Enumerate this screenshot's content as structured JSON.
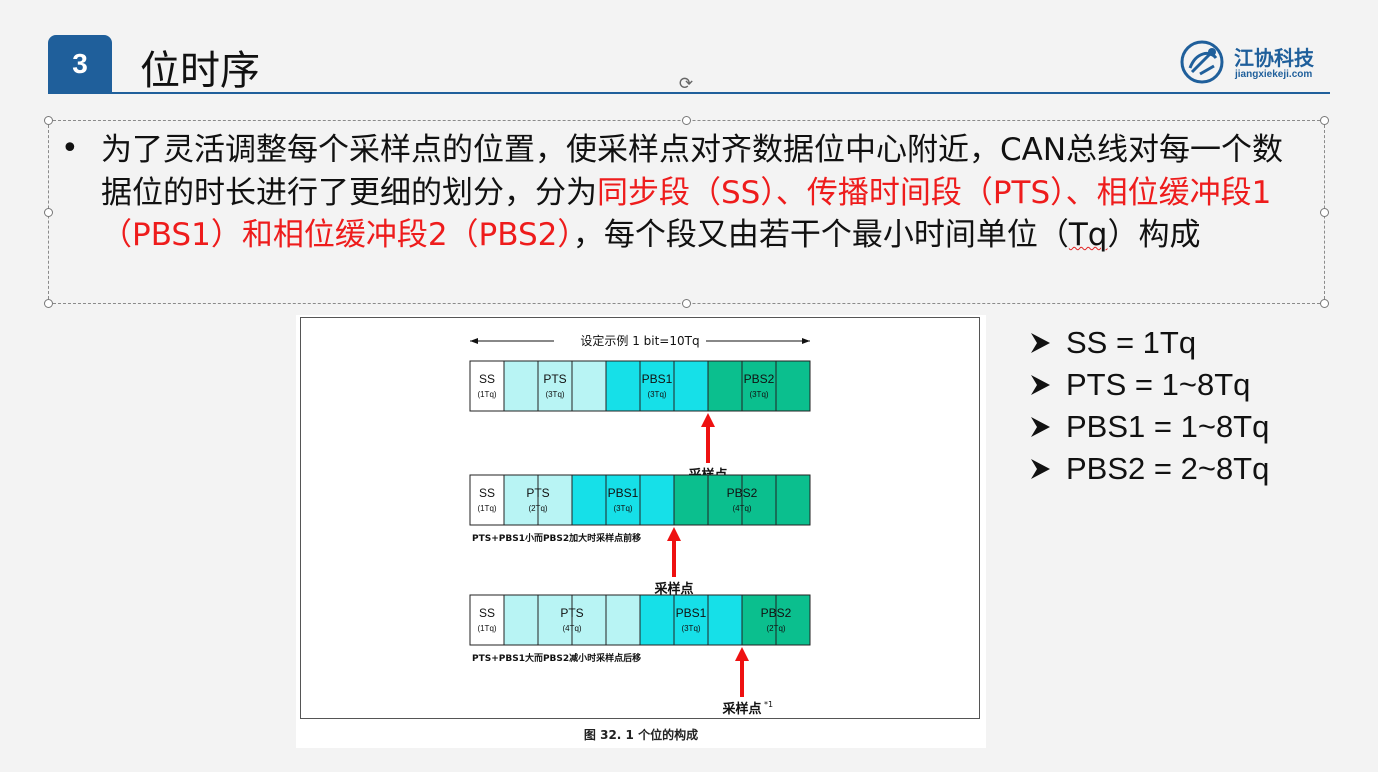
{
  "header": {
    "number": "3",
    "title": "位时序",
    "logo_name": "江协科技",
    "logo_url": "jiangxiekeji.com"
  },
  "colors": {
    "accent": "#1f5f9b",
    "highlight": "#ee1c1c",
    "ss": "#ffffff",
    "pts": "#b8f4f4",
    "pbs1": "#16e0e8",
    "pbs2": "#0bbf8e",
    "arrow": "#ee1111"
  },
  "body": {
    "seg1": "为了灵活调整每个采样点的位置，使采样点对齐数据位中心附近，CAN总线对每一个数据位的时长进行了更细的划分，分为",
    "seg2_red": "同步段（SS）、传播时间段（PTS）、相位缓冲段1（PBS1）和相位缓冲段2（PBS2）",
    "seg3": "，每个段又由若干个最小时间单位（",
    "seg4_squiggle": "Tq",
    "seg5": "）构成"
  },
  "formulas": [
    "SS = 1Tq",
    "PTS = 1~8Tq",
    "PBS1 = 1~8Tq",
    "PBS2 = 2~8Tq"
  ],
  "figure": {
    "top_label": "设定示例 1 bit=10Tq",
    "caption": "图 32.   1 个位的构成",
    "sample_label": "采样点",
    "sample_label_note": "*1",
    "rows": [
      {
        "segments": [
          {
            "name": "SS",
            "tq_label": "(1Tq)",
            "tq": 1,
            "kind": "ss"
          },
          {
            "name": "PTS",
            "tq_label": "(3Tq)",
            "tq": 3,
            "kind": "pts"
          },
          {
            "name": "PBS1",
            "tq_label": "(3Tq)",
            "tq": 3,
            "kind": "pbs1"
          },
          {
            "name": "PBS2",
            "tq_label": "(3Tq)",
            "tq": 3,
            "kind": "pbs2"
          }
        ],
        "note": ""
      },
      {
        "segments": [
          {
            "name": "SS",
            "tq_label": "(1Tq)",
            "tq": 1,
            "kind": "ss"
          },
          {
            "name": "PTS",
            "tq_label": "(2Tq)",
            "tq": 2,
            "kind": "pts"
          },
          {
            "name": "PBS1",
            "tq_label": "(3Tq)",
            "tq": 3,
            "kind": "pbs1"
          },
          {
            "name": "PBS2",
            "tq_label": "(4Tq)",
            "tq": 4,
            "kind": "pbs2"
          }
        ],
        "note": "PTS+PBS1小而PBS2加大时采样点前移"
      },
      {
        "segments": [
          {
            "name": "SS",
            "tq_label": "(1Tq)",
            "tq": 1,
            "kind": "ss"
          },
          {
            "name": "PTS",
            "tq_label": "(4Tq)",
            "tq": 4,
            "kind": "pts"
          },
          {
            "name": "PBS1",
            "tq_label": "(3Tq)",
            "tq": 3,
            "kind": "pbs1"
          },
          {
            "name": "PBS2",
            "tq_label": "(2Tq)",
            "tq": 2,
            "kind": "pbs2"
          }
        ],
        "note": "PTS+PBS1大而PBS2减小时采样点后移"
      }
    ]
  }
}
